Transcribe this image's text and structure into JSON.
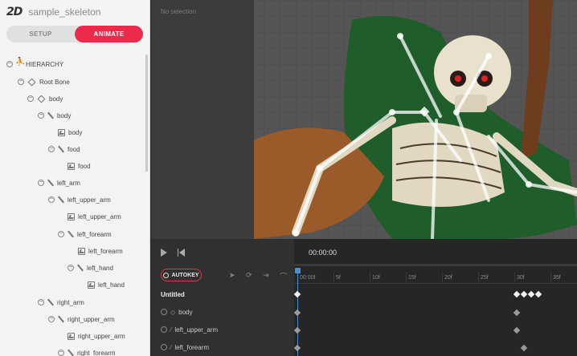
{
  "header": {
    "logo": "2D",
    "project_name": "sample_skeleton"
  },
  "mode_tabs": {
    "setup": "SETUP",
    "animate": "ANIMATE",
    "active": "animate"
  },
  "hierarchy": {
    "title": "HIERARCHY",
    "nodes": [
      {
        "label": "Root Bone",
        "icon": "root-icon"
      },
      {
        "label": "body",
        "icon": "root-icon"
      },
      {
        "label": "body",
        "icon": "bone-icon"
      },
      {
        "label": "body",
        "icon": "image-icon"
      },
      {
        "label": "food",
        "icon": "bone-icon"
      },
      {
        "label": "food",
        "icon": "image-icon"
      },
      {
        "label": "left_arm",
        "icon": "bone-icon"
      },
      {
        "label": "left_upper_arm",
        "icon": "bone-icon"
      },
      {
        "label": "left_upper_arm",
        "icon": "image-icon"
      },
      {
        "label": "left_forearm",
        "icon": "bone-icon"
      },
      {
        "label": "left_forearm",
        "icon": "image-icon"
      },
      {
        "label": "left_hand",
        "icon": "bone-icon"
      },
      {
        "label": "left_hand",
        "icon": "image-icon"
      },
      {
        "label": "right_arm",
        "icon": "bone-icon"
      },
      {
        "label": "right_upper_arm",
        "icon": "bone-icon"
      },
      {
        "label": "right_upper_arm",
        "icon": "image-icon"
      },
      {
        "label": "right_forearm",
        "icon": "bone-icon"
      }
    ]
  },
  "viewport": {
    "selection_text": "No selection"
  },
  "timeline": {
    "current_time": "00:00:00",
    "autokey_label": "AUTOKEY",
    "ruler_ticks": [
      "00:00f",
      "5f",
      "10f",
      "15f",
      "20f",
      "25f",
      "30f",
      "35f"
    ],
    "animation_name": "Untitled",
    "tracks": [
      "body",
      "left_upper_arm",
      "left_forearm"
    ]
  },
  "colors": {
    "accent": "#ec2a4a",
    "playhead": "#4a8fd6"
  }
}
